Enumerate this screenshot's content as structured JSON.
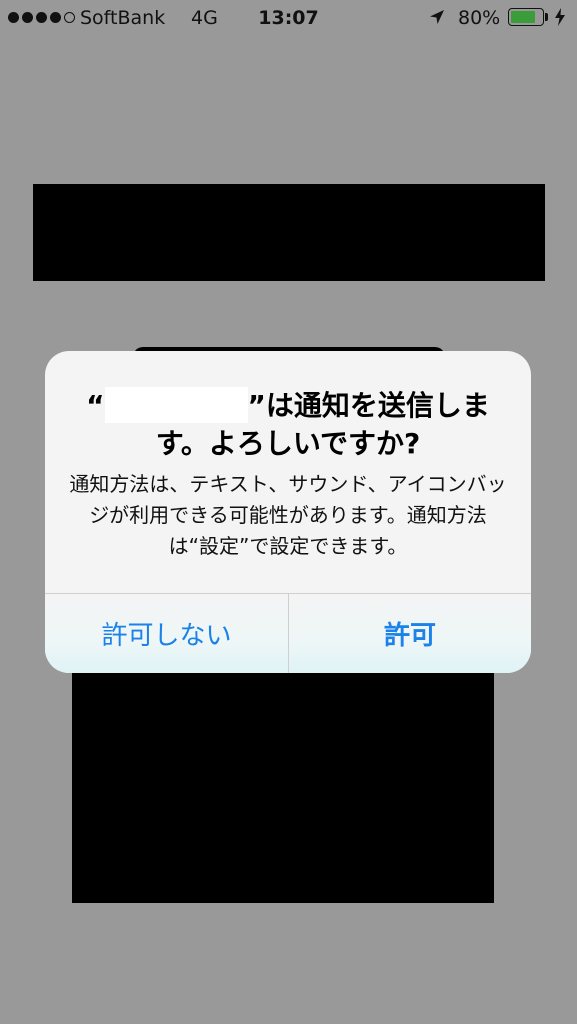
{
  "status_bar": {
    "carrier": "SoftBank",
    "network": "4G",
    "time": "13:07",
    "battery_percent_label": "80%",
    "battery_level": 0.8,
    "signal_strength": 4,
    "signal_max": 5,
    "location_icon": "location-arrow-icon",
    "charging_icon": "bolt-icon"
  },
  "alert": {
    "title_open_quote": "“",
    "title_rest": "”は通知を送信します。よろしいですか?",
    "message": "通知方法は、テキスト、サウンド、アイコンバッジが利用できる可能性があります。通知方法は“設定”で設定できます。",
    "deny_label": "許可しない",
    "allow_label": "許可"
  },
  "colors": {
    "background": "#999999",
    "alert_background": "#f4f4f4",
    "button_text": "#1a82e8",
    "battery_fill": "#3b9d3a"
  }
}
